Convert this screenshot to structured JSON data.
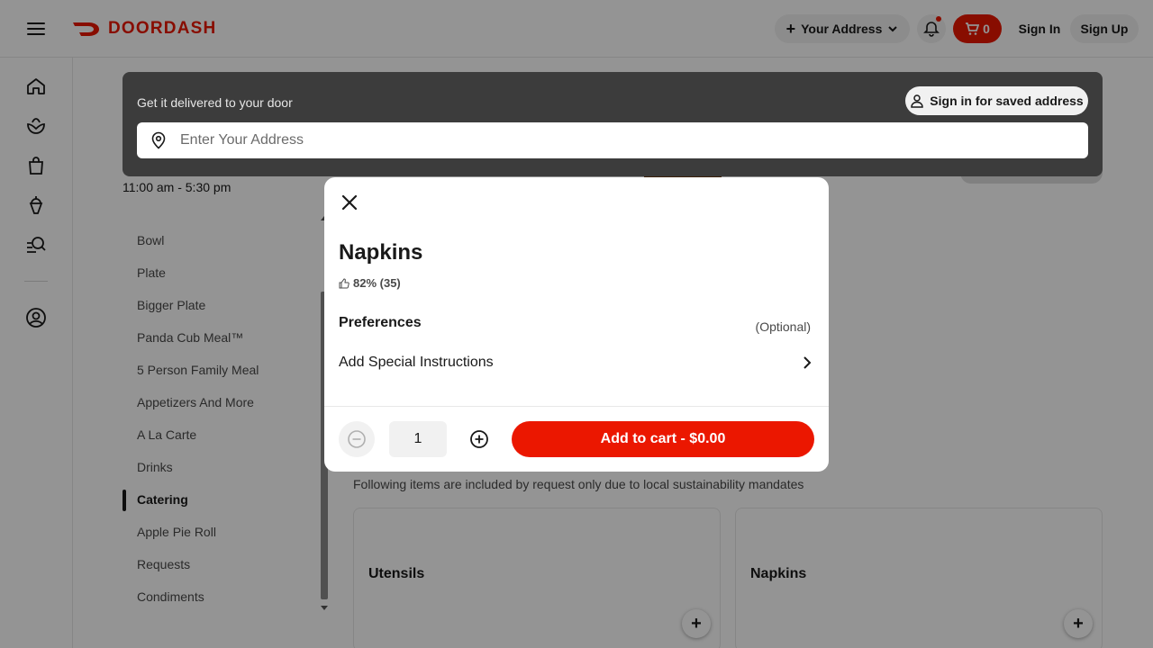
{
  "header": {
    "brand": "DOORDASH",
    "address_pill": "Your Address",
    "cart_count": "0",
    "sign_in": "Sign In",
    "sign_up": "Sign Up"
  },
  "left_rail": {
    "icons": [
      "home-icon",
      "grocery-icon",
      "retail-icon",
      "dessert-icon",
      "browse-icon",
      "account-icon"
    ]
  },
  "store": {
    "hours": "11:00 am - 5:30 pm"
  },
  "menu_nav": {
    "items": [
      {
        "label": "Bowl"
      },
      {
        "label": "Plate"
      },
      {
        "label": "Bigger Plate"
      },
      {
        "label": "Panda Cub Meal™"
      },
      {
        "label": "5 Person Family Meal"
      },
      {
        "label": "Appetizers And More"
      },
      {
        "label": "A La Carte"
      },
      {
        "label": "Drinks"
      },
      {
        "label": "Catering"
      },
      {
        "label": "Apple Pie Roll"
      },
      {
        "label": "Requests"
      },
      {
        "label": "Condiments"
      }
    ],
    "active": "Catering"
  },
  "section": {
    "subtitle": "Following items are included by request only due to local sustainability mandates",
    "cards": [
      {
        "title": "Utensils"
      },
      {
        "title": "Napkins"
      }
    ]
  },
  "address_bar": {
    "label": "Get it delivered to your door",
    "saved_button": "Sign in for saved address",
    "placeholder": "Enter Your Address"
  },
  "modal": {
    "title": "Napkins",
    "rating": "82% (35)",
    "preferences_title": "Preferences",
    "preferences_optional": "(Optional)",
    "special_instructions": "Add Special Instructions",
    "quantity": "1",
    "add_to_cart": "Add to cart - $0.00"
  },
  "colors": {
    "brand": "#eb1700",
    "address_panel": "#3c3c3c"
  }
}
